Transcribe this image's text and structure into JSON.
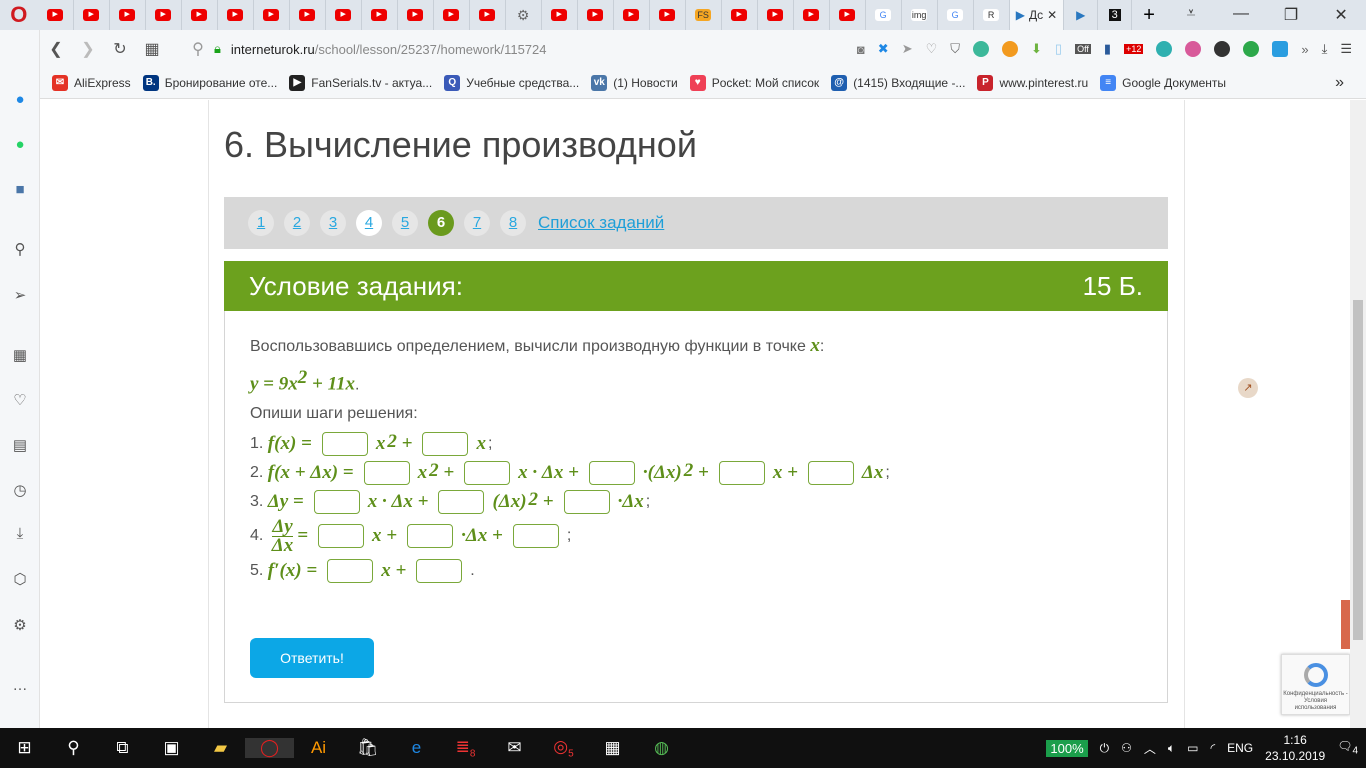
{
  "browser": {
    "tabs": [
      "yt",
      "yt",
      "yt",
      "yt",
      "yt",
      "yt",
      "yt",
      "yt",
      "yt",
      "yt",
      "yt",
      "yt",
      "yt",
      "gear",
      "yt",
      "yt",
      "yt",
      "yt",
      "FS",
      "yt",
      "yt",
      "yt",
      "yt",
      "G",
      "img",
      "G",
      "R"
    ],
    "active_tab": "Дс",
    "extra_tabs": [
      "▶",
      "3"
    ],
    "url_domain": "interneturok.ru",
    "url_path": "/school/lesson/25237/homework/115724",
    "ext_badges": {
      "off": "Off",
      "count": "+12"
    },
    "bookmarks": [
      {
        "label": "AliExpress",
        "icon": "✉",
        "color": "#e43225"
      },
      {
        "label": "Бронирование оте...",
        "icon": "B.",
        "color": "#003580"
      },
      {
        "label": "FanSerials.tv - актуа...",
        "icon": "▶",
        "color": "#222"
      },
      {
        "label": "Учебные средства...",
        "icon": "Q",
        "color": "#3a5ab8"
      },
      {
        "label": "(1) Новости",
        "icon": "vk",
        "color": "#4a76a8"
      },
      {
        "label": "Pocket: Мой список",
        "icon": "♥",
        "color": "#ef4056"
      },
      {
        "label": "(1415) Входящие -...",
        "icon": "@",
        "color": "#1f5fb0"
      },
      {
        "label": "www.pinterest.ru",
        "icon": "P",
        "color": "#c8232c"
      },
      {
        "label": "Google Документы",
        "icon": "≡",
        "color": "#4285f4"
      }
    ]
  },
  "page": {
    "title": "6. Вычисление производной",
    "pages": [
      "1",
      "2",
      "3",
      "4",
      "5",
      "6",
      "7",
      "8"
    ],
    "current_page": "6",
    "list_link": "Список заданий",
    "task_header": "Условие задания:",
    "points": "15 Б.",
    "prompt": "Воспользовавшись определением, вычисли производную функции в точке ",
    "prompt_var": "x",
    "prompt_end": ":",
    "function": "y = 9x",
    "function_sup": "2",
    "function_rest": " + 11x",
    "function_end": ".",
    "steps_label": "Опиши шаги решения:",
    "steps": [
      [
        {
          "t": "1. "
        },
        {
          "m": "f(x) ="
        },
        {
          "box": 1
        },
        {
          "m": "x"
        },
        {
          "sup": "2"
        },
        {
          "m": " +"
        },
        {
          "box": 1
        },
        {
          "m": "x"
        },
        {
          "t": ";"
        }
      ],
      [
        {
          "t": "2. "
        },
        {
          "m": "f(x + Δx) ="
        },
        {
          "box": 1
        },
        {
          "m": "x"
        },
        {
          "sup": "2"
        },
        {
          "m": " +"
        },
        {
          "box": 1
        },
        {
          "m": "x · Δx +"
        },
        {
          "box": 1
        },
        {
          "m": "·(Δx)"
        },
        {
          "sup": "2"
        },
        {
          "m": " +"
        },
        {
          "box": 1
        },
        {
          "m": "x +"
        },
        {
          "box": 1
        },
        {
          "m": "Δx"
        },
        {
          "t": ";"
        }
      ],
      [
        {
          "t": "3. "
        },
        {
          "m": "Δy ="
        },
        {
          "box": 1
        },
        {
          "m": "x · Δx +"
        },
        {
          "box": 1
        },
        {
          "m": "(Δx)"
        },
        {
          "sup": "2"
        },
        {
          "m": " +"
        },
        {
          "box": 1
        },
        {
          "m": "·Δx"
        },
        {
          "t": ";"
        }
      ],
      [
        {
          "t": "4. "
        },
        {
          "frac": [
            "Δy",
            "Δx"
          ]
        },
        {
          "m": "="
        },
        {
          "box": 1
        },
        {
          "m": "x +"
        },
        {
          "box": 1
        },
        {
          "m": "·Δx +"
        },
        {
          "box": 1
        },
        {
          "t": ";"
        }
      ],
      [
        {
          "t": "5. "
        },
        {
          "m": "f′(x) ="
        },
        {
          "box": 1
        },
        {
          "m": "x +"
        },
        {
          "box": 1
        },
        {
          "t": "."
        }
      ]
    ],
    "submit": "Ответить!",
    "recaptcha": "Конфиденциальность - Условия использования"
  },
  "taskbar": {
    "battery": "100%",
    "lang": "ENG",
    "time": "1:16",
    "date": "23.10.2019",
    "notifications": "4",
    "badge_app1": "8",
    "badge_app2": "5"
  },
  "colors": {
    "green": "#6ca11e",
    "blue": "#0ca7e6"
  }
}
